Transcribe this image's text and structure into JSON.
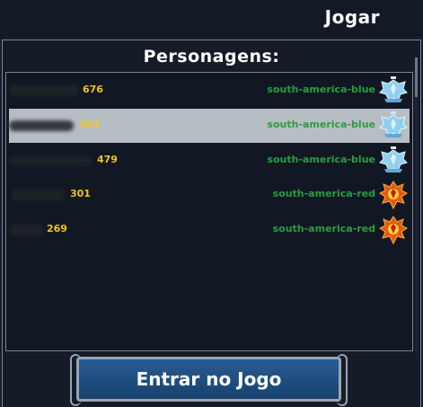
{
  "window": {
    "title": "Jogar"
  },
  "panel": {
    "title": "Personagens:"
  },
  "characters": [
    {
      "level": "676",
      "region": "south-america-blue",
      "team": "blue",
      "selected": false
    },
    {
      "level": "501",
      "region": "south-america-blue",
      "team": "blue",
      "selected": true
    },
    {
      "level": "479",
      "region": "south-america-blue",
      "team": "blue",
      "selected": false
    },
    {
      "level": "301",
      "region": "south-america-red",
      "team": "red",
      "selected": false
    },
    {
      "level": "269",
      "region": "south-america-red",
      "team": "red",
      "selected": false
    }
  ],
  "actions": {
    "enter_label": "Entrar no Jogo"
  },
  "colors": {
    "level": "#f2c41c",
    "region": "#2b9c3f",
    "selected_row": "#b7bec3",
    "button": "#1f4f84",
    "blue_emblem": "#8fd0f0",
    "red_emblem": "#e25a18"
  },
  "icons": {
    "blue_team": "blue-eagle-emblem-icon",
    "red_team": "red-phoenix-emblem-icon"
  }
}
